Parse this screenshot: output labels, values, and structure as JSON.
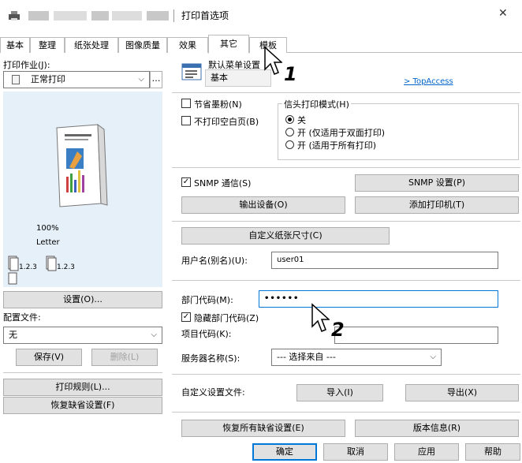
{
  "window": {
    "title": "打印首选项",
    "close_glyph": "✕"
  },
  "tabs": [
    {
      "label": "基本"
    },
    {
      "label": "整理"
    },
    {
      "label": "纸张处理"
    },
    {
      "label": "图像质量"
    },
    {
      "label": "效果"
    },
    {
      "label": "其它",
      "active": true
    },
    {
      "label": "模板"
    }
  ],
  "left": {
    "print_job_label": "打印作业(J):",
    "print_job_value": "正常打印",
    "zoom": "100%",
    "paper": "Letter",
    "page_tag_1": "1.2.3",
    "page_tag_2": "1.2.3",
    "settings_button": "设置(O)...",
    "profile_label": "配置文件:",
    "profile_value": "无",
    "save_button": "保存(V)",
    "delete_button": "删除(L)",
    "print_rules_button": "打印规则(L)...",
    "restore_defaults_button": "恢复缺省设置(F)"
  },
  "right": {
    "default_menu_label": "默认菜单设置",
    "default_menu_value": "基本",
    "topaccess_link": "> TopAccess",
    "toner_save_label": "节省墨粉(N)",
    "skip_blank_label": "不打印空白页(B)",
    "letterhead_group_label": "信头打印模式(H)",
    "letterhead_options": [
      "关",
      "开 (仅适用于双面打印)",
      "开 (适用于所有打印)"
    ],
    "snmp_label": "SNMP 通信(S)",
    "snmp_settings_button": "SNMP 设置(P)",
    "output_device_button": "输出设备(O)",
    "add_printer_button": "添加打印机(T)",
    "custom_paper_button": "自定义纸张尺寸(C)",
    "username_label": "用户名(别名)(U):",
    "username_value": "user01",
    "dept_code_label": "部门代码(M):",
    "dept_code_value": "••••••",
    "hide_dept_label": "隐藏部门代码(Z)",
    "project_code_label": "项目代码(K):",
    "server_name_label": "服务器名称(S):",
    "server_name_value": "--- 选择来自 ---",
    "custom_settings_label": "自定义设置文件:",
    "import_button": "导入(I)",
    "export_button": "导出(X)",
    "restore_all_button": "恢复所有缺省设置(E)",
    "version_button": "版本信息(R)"
  },
  "footer": {
    "ok": "确定",
    "cancel": "取消",
    "apply": "应用",
    "help": "帮助"
  },
  "callouts": [
    "1",
    "2"
  ]
}
